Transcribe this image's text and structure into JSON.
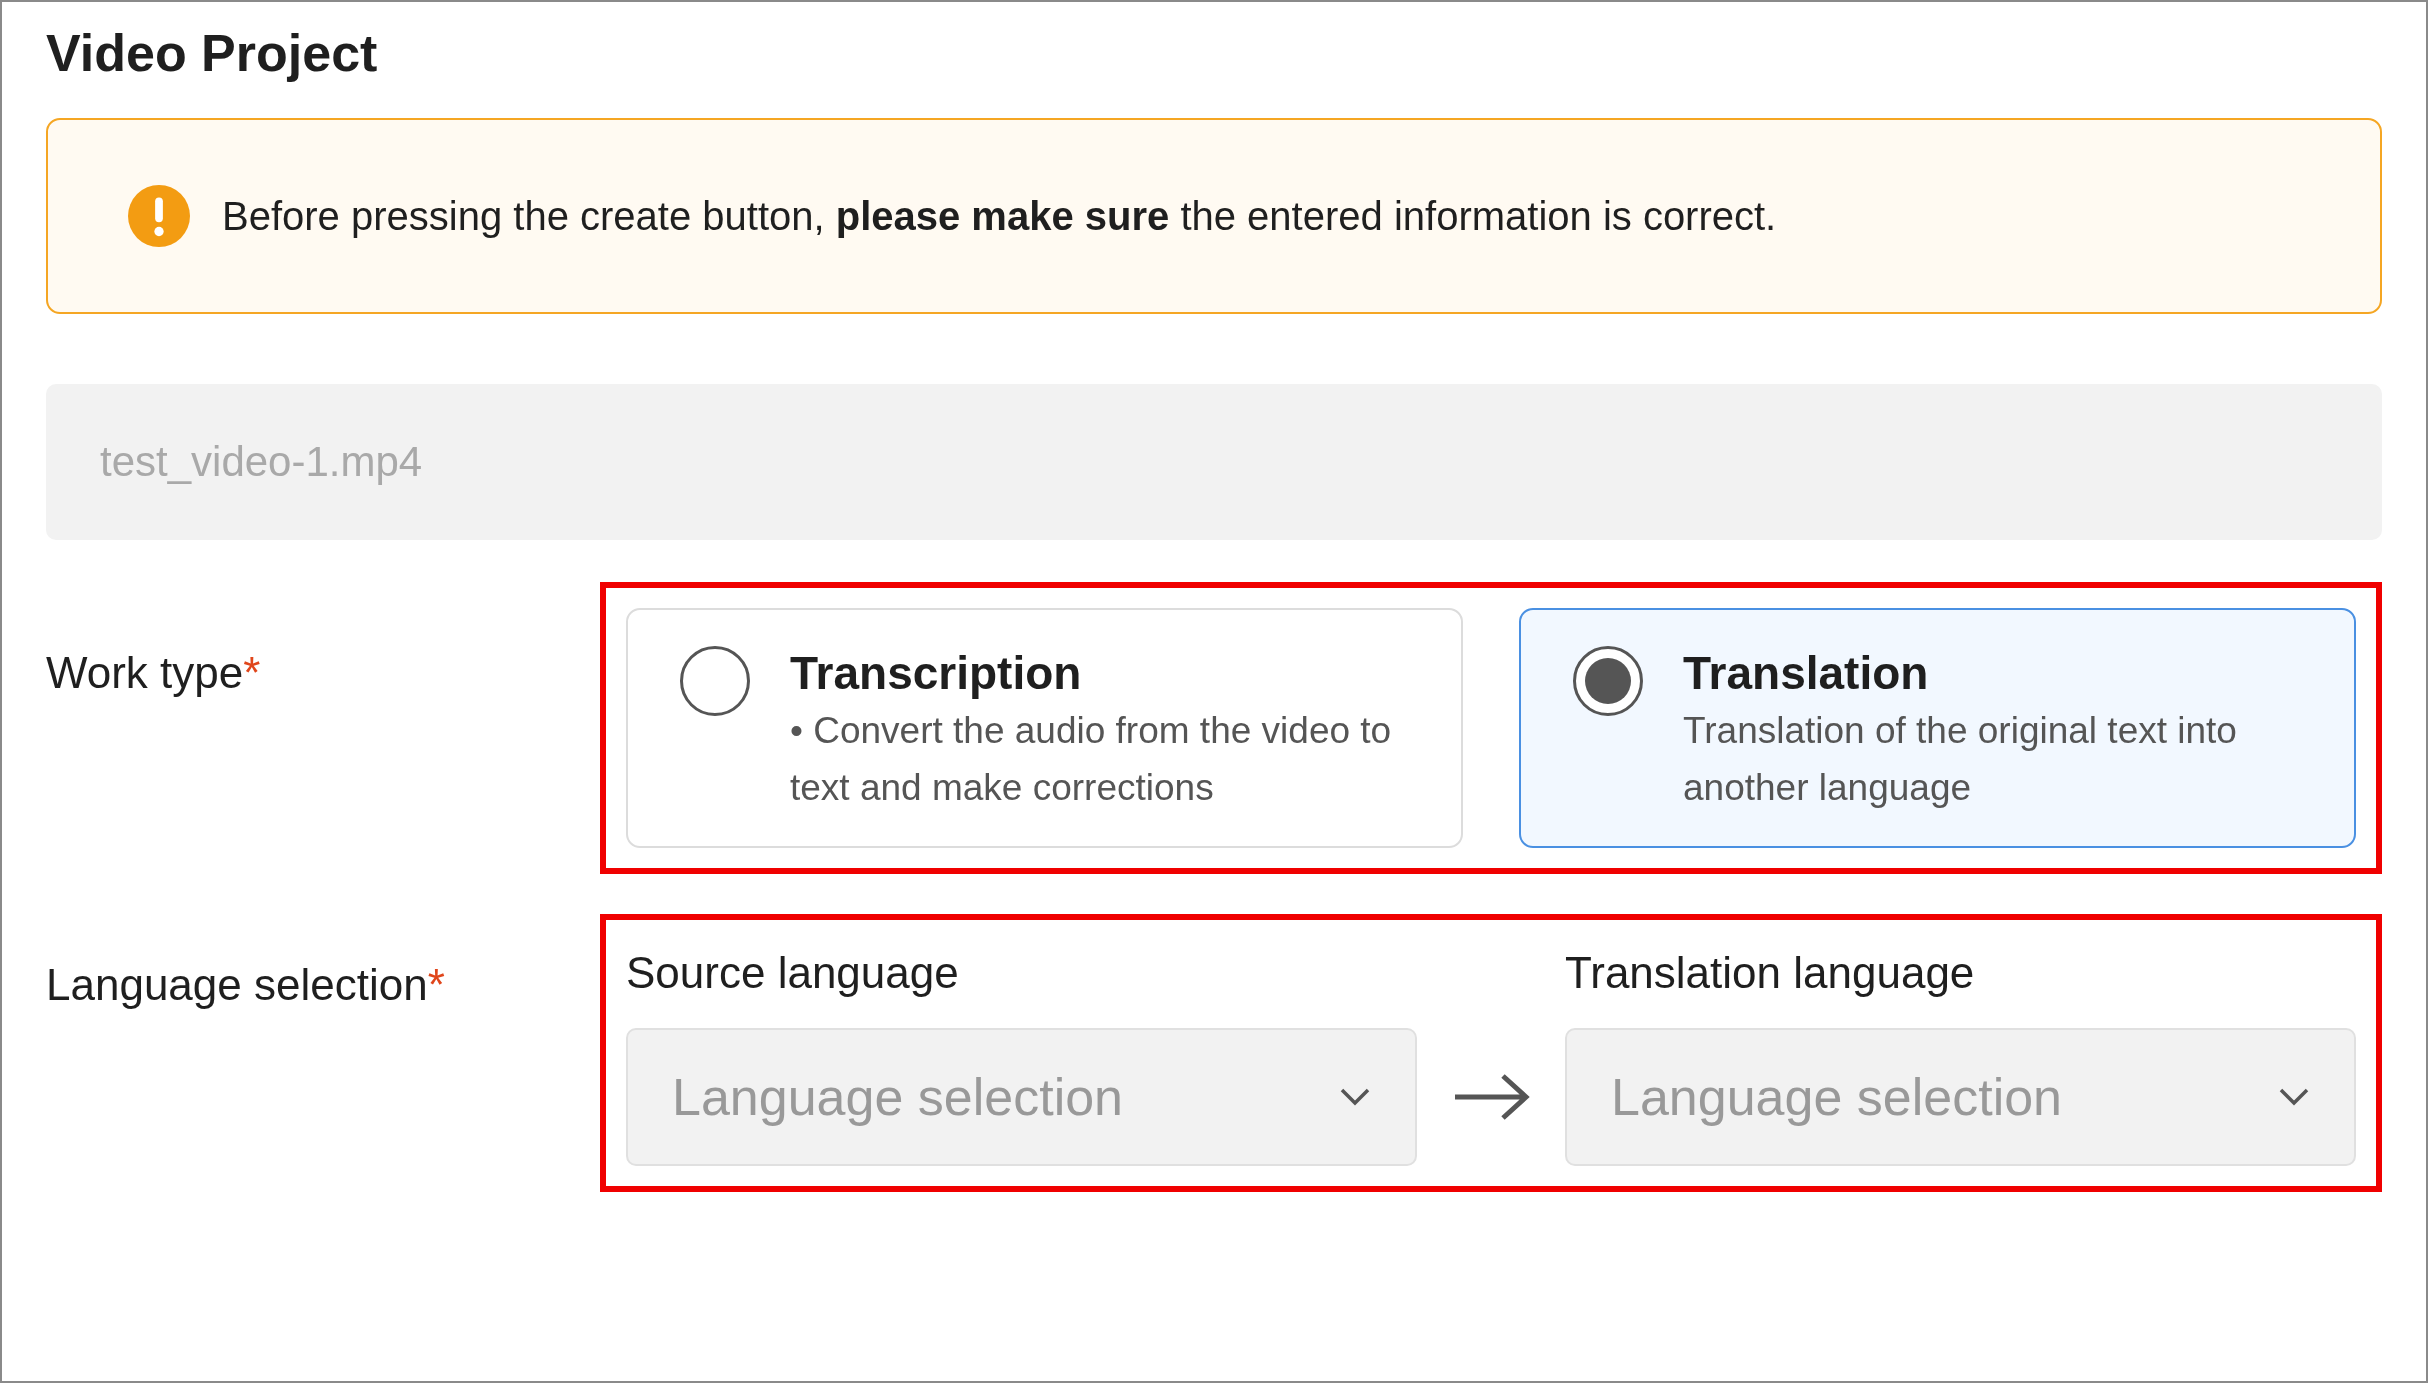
{
  "title": "Video Project",
  "alert": {
    "text": "Before pressing the create button, **please make sure** the entered information is correct."
  },
  "file_field": {
    "value": "test_video-1.mp4"
  },
  "work_type": {
    "label": "Work type",
    "required_mark": "*",
    "highlighted": true,
    "options": [
      {
        "title": "Transcription",
        "description": "• Convert the audio from the video to text and make corrections",
        "selected": false
      },
      {
        "title": "Translation",
        "description": "Translation of the original text into another language",
        "selected": true
      }
    ]
  },
  "language_selection": {
    "label": "Language selection",
    "required_mark": "*",
    "highlighted": true,
    "source": {
      "label": "Source language",
      "placeholder": "Language selection"
    },
    "target": {
      "label": "Translation language",
      "placeholder": "Language selection"
    }
  }
}
